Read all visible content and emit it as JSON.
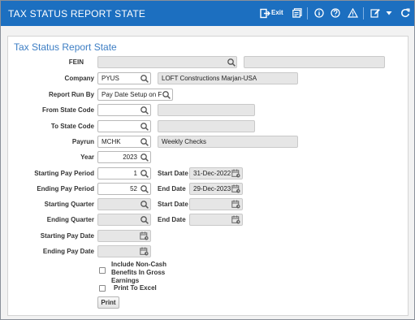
{
  "window": {
    "title": "TAX STATUS REPORT STATE",
    "exit_label": "Exit"
  },
  "toolbar_icons": [
    "exit-icon",
    "report-icon",
    "info-icon",
    "help-icon",
    "warning-icon",
    "edit-icon",
    "chevron-down-icon",
    "refresh-icon"
  ],
  "panel": {
    "title": "Tax Status Report State"
  },
  "form": {
    "fein": {
      "label": "FEIN",
      "value": "",
      "desc": ""
    },
    "company": {
      "label": "Company",
      "value": "PYUS",
      "desc": "LOFT Constructions Marjan-USA"
    },
    "report_run_by": {
      "label": "Report Run By",
      "value": "Pay Date Setup on F"
    },
    "from_state": {
      "label": "From State Code",
      "value": "",
      "desc": ""
    },
    "to_state": {
      "label": "To State Code",
      "value": "",
      "desc": ""
    },
    "payrun": {
      "label": "Payrun",
      "value": "MCHK",
      "desc": "Weekly Checks"
    },
    "year": {
      "label": "Year",
      "value": "2023"
    },
    "starting_pay_period": {
      "label": "Starting Pay Period",
      "value": "1",
      "date_label": "Start Date",
      "date": "31-Dec-2022"
    },
    "ending_pay_period": {
      "label": "Ending Pay Period",
      "value": "52",
      "date_label": "End Date",
      "date": "29-Dec-2023"
    },
    "starting_quarter": {
      "label": "Starting Quarter",
      "value": "",
      "date_label": "Start Date",
      "date": ""
    },
    "ending_quarter": {
      "label": "Ending Quarter",
      "value": "",
      "date_label": "End Date",
      "date": ""
    },
    "starting_pay_date": {
      "label": "Starting Pay Date",
      "value": ""
    },
    "ending_pay_date": {
      "label": "Ending Pay Date",
      "value": ""
    },
    "include_noncash": {
      "label_lines": [
        "Include Non-Cash",
        "Benefits In Gross",
        "Earnings"
      ],
      "checked": false
    },
    "print_to_excel": {
      "label": "Print To Excel",
      "checked": false
    },
    "print_button": "Print"
  }
}
